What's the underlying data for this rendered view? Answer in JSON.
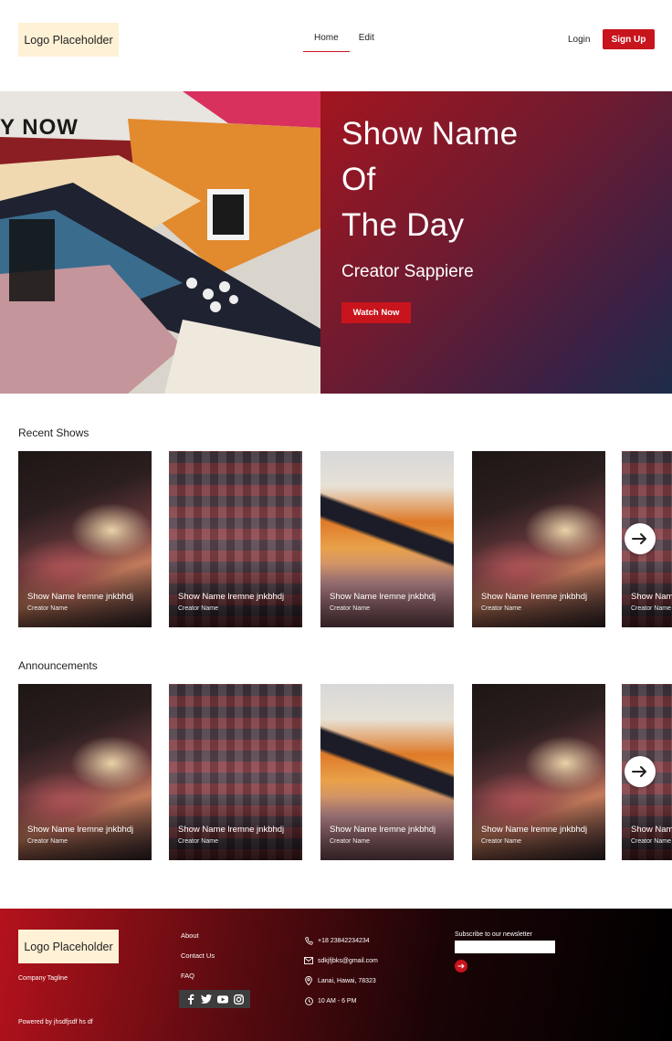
{
  "header": {
    "logo": "Logo Placeholder",
    "nav": [
      {
        "label": "Home",
        "active": true
      },
      {
        "label": "Edit",
        "active": false
      }
    ],
    "login": "Login",
    "signup": "Sign Up"
  },
  "hero": {
    "title_lines": [
      "Show Name",
      "Of",
      "The Day"
    ],
    "creator": "Creator Sappiere",
    "cta": "Watch Now",
    "poster_text": "Y NOW"
  },
  "recent": {
    "title": "Recent Shows",
    "cards": [
      {
        "title": "Show Name lremne jnkbhdj",
        "creator": "Creator Name",
        "art": "a"
      },
      {
        "title": "Show Name lremne jnkbhdj",
        "creator": "Creator Name",
        "art": "b"
      },
      {
        "title": "Show Name lremne jnkbhdj",
        "creator": "Creator Name",
        "art": "c"
      },
      {
        "title": "Show Name lremne jnkbhdj",
        "creator": "Creator Name",
        "art": "a"
      },
      {
        "title": "Show Nam",
        "creator": "Creator Name",
        "art": "b"
      }
    ]
  },
  "announcements": {
    "title": "Announcements",
    "cards": [
      {
        "title": "Show Name lremne jnkbhdj",
        "creator": "Creator Name",
        "art": "a"
      },
      {
        "title": "Show Name lremne jnkbhdj",
        "creator": "Creator Name",
        "art": "b"
      },
      {
        "title": "Show Name lremne jnkbhdj",
        "creator": "Creator Name",
        "art": "c"
      },
      {
        "title": "Show Name lremne jnkbhdj",
        "creator": "Creator Name",
        "art": "a"
      },
      {
        "title": "Show Nam",
        "creator": "Creator Name",
        "art": "b"
      }
    ]
  },
  "footer": {
    "logo": "Logo Placeholder",
    "tagline": "Company Tagline",
    "powered": "Powered by jhsdfjsdf hs df",
    "links": [
      "About",
      "Contact Us",
      "FAQ"
    ],
    "social": [
      "facebook-icon",
      "twitter-icon",
      "youtube-icon",
      "instagram-icon"
    ],
    "contact": [
      {
        "icon": "phone-icon",
        "text": "+18 23842234234"
      },
      {
        "icon": "mail-icon",
        "text": "sdkjfjbks@gmail.com"
      },
      {
        "icon": "location-pin-icon",
        "text": "Lanai, Hawai, 78323"
      },
      {
        "icon": "clock-icon",
        "text": "10 AM - 6 PM"
      }
    ],
    "newsletter_label": "Subscribe to our newsletter",
    "newsletter_placeholder": ""
  },
  "colors": {
    "accent": "#c8141c",
    "logo_bg": "#fff1d6"
  }
}
